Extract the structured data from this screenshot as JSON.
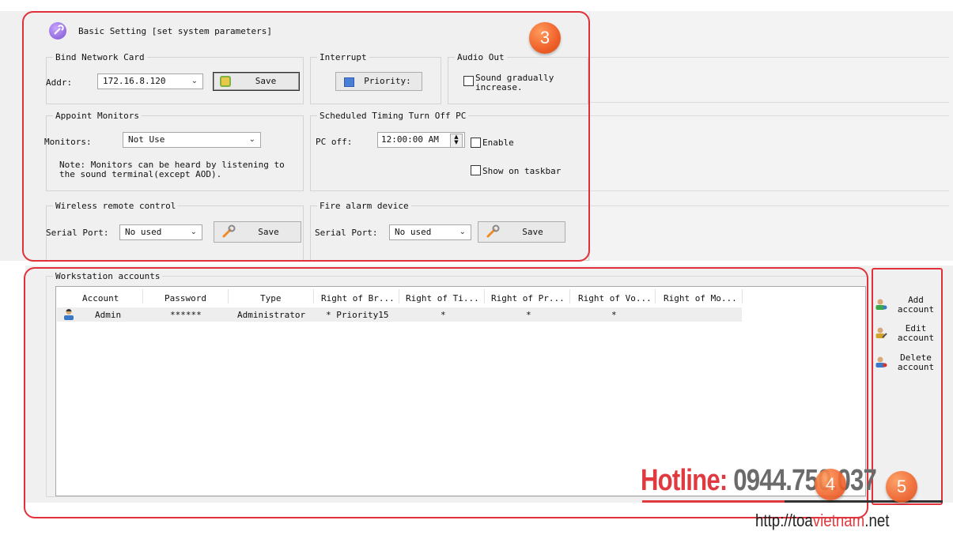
{
  "basic_setting": {
    "title": "Basic Setting [set system parameters]",
    "bind_network_card": {
      "title": "Bind Network Card",
      "addr_label": "Addr:",
      "addr_value": "172.16.8.120",
      "save_label": "Save"
    },
    "interrupt": {
      "title": "Interrupt",
      "priority_label": "Priority:"
    },
    "audio_out": {
      "title": "Audio Out",
      "sound_gradually_label_1": "Sound gradually",
      "sound_gradually_label_2": "increase."
    },
    "appoint_monitors": {
      "title": "Appoint Monitors",
      "monitors_label": "Monitors:",
      "monitors_value": "Not Use",
      "note_1": "Note: Monitors can be heard by listening to",
      "note_2": "the sound terminal(except AOD)."
    },
    "scheduled_off": {
      "title": "Scheduled Timing Turn Off PC",
      "pc_off_label": "PC off:",
      "time_value": "12:00:00 AM",
      "enable_label": "Enable",
      "show_taskbar_label": "Show on taskbar"
    },
    "wireless_remote": {
      "title": "Wireless remote control",
      "serial_port_label": "Serial Port:",
      "serial_port_value": "No used",
      "save_label": "Save"
    },
    "fire_alarm": {
      "title": "Fire alarm device",
      "serial_port_label": "Serial Port:",
      "serial_port_value": "No used",
      "save_label": "Save"
    }
  },
  "workstation_accounts": {
    "title": "Workstation accounts",
    "columns": [
      "Account",
      "Password",
      "Type",
      "Right of Br...",
      "Right of Ti...",
      "Right of Pr...",
      "Right of Vo...",
      "Right of Mo..."
    ],
    "rows": [
      {
        "account": "Admin",
        "password": "******",
        "type": "Administrator",
        "right_br": "* Priority15",
        "right_ti": "*",
        "right_pr": "*",
        "right_vo": "*",
        "right_mo": ""
      }
    ]
  },
  "side_actions": {
    "add_1": "Add",
    "add_2": "account",
    "edit_1": "Edit",
    "edit_2": "account",
    "delete_1": "Delete",
    "delete_2": "account"
  },
  "annotations": {
    "badge_3": "3",
    "badge_4": "4",
    "badge_5": "5"
  },
  "watermark": {
    "hotline_label": "Hotline: ",
    "hotline_number": "0944.750.037",
    "url_prefix": "http://toa",
    "url_highlight": "vietnam",
    "url_suffix": ".net"
  },
  "colors": {
    "annotation_red": "#e0303a",
    "badge_orange": "#f0612a",
    "hotline_red": "#e03a40",
    "hotline_gray": "#6b6b6b"
  }
}
